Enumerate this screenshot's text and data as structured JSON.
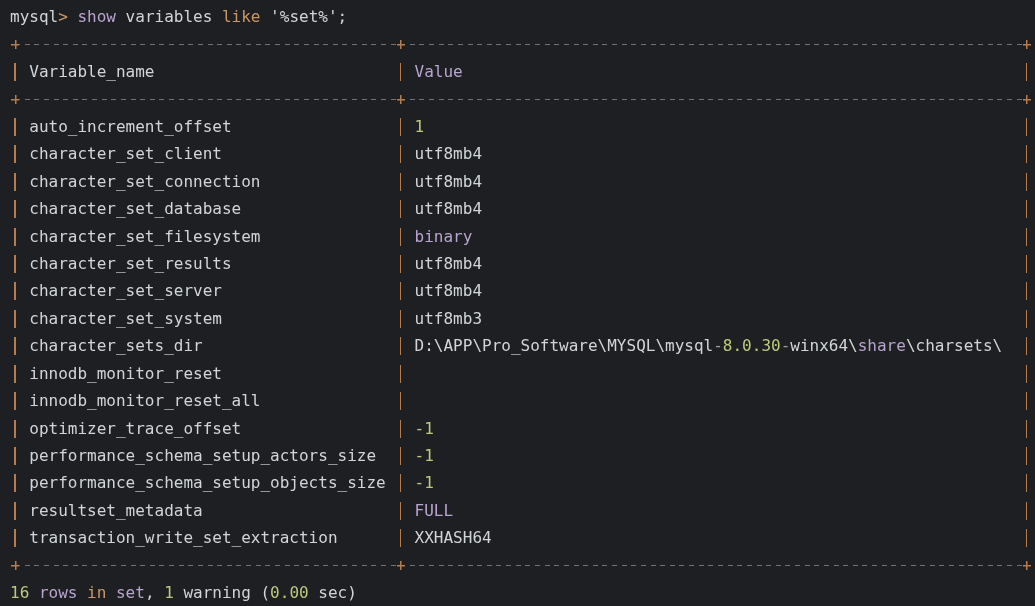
{
  "prompt": {
    "segments": [
      {
        "text": "mysql",
        "kind": "plain"
      },
      {
        "text": ">",
        "kind": "operator"
      },
      {
        "text": " show",
        "kind": "keyword"
      },
      {
        "text": " variables ",
        "kind": "plain"
      },
      {
        "text": "like",
        "kind": "operator"
      },
      {
        "text": " '%set%';",
        "kind": "plain"
      }
    ]
  },
  "table": {
    "columns": [
      {
        "segments": [
          {
            "text": "Variable_name",
            "kind": "plain"
          }
        ]
      },
      {
        "segments": [
          {
            "text": "Value",
            "kind": "keyword"
          }
        ]
      }
    ],
    "rows": [
      {
        "name": [
          {
            "text": "auto_increment_offset",
            "kind": "plain"
          }
        ],
        "value": [
          {
            "text": "1",
            "kind": "number"
          }
        ]
      },
      {
        "name": [
          {
            "text": "character_set_client",
            "kind": "plain"
          }
        ],
        "value": [
          {
            "text": "utf8mb4",
            "kind": "plain"
          }
        ]
      },
      {
        "name": [
          {
            "text": "character_set_connection",
            "kind": "plain"
          }
        ],
        "value": [
          {
            "text": "utf8mb4",
            "kind": "plain"
          }
        ]
      },
      {
        "name": [
          {
            "text": "character_set_database",
            "kind": "plain"
          }
        ],
        "value": [
          {
            "text": "utf8mb4",
            "kind": "plain"
          }
        ]
      },
      {
        "name": [
          {
            "text": "character_set_filesystem",
            "kind": "plain"
          }
        ],
        "value": [
          {
            "text": "binary",
            "kind": "keyword"
          }
        ]
      },
      {
        "name": [
          {
            "text": "character_set_results",
            "kind": "plain"
          }
        ],
        "value": [
          {
            "text": "utf8mb4",
            "kind": "plain"
          }
        ]
      },
      {
        "name": [
          {
            "text": "character_set_server",
            "kind": "plain"
          }
        ],
        "value": [
          {
            "text": "utf8mb4",
            "kind": "plain"
          }
        ]
      },
      {
        "name": [
          {
            "text": "character_set_system",
            "kind": "plain"
          }
        ],
        "value": [
          {
            "text": "utf8mb3",
            "kind": "plain"
          }
        ]
      },
      {
        "name": [
          {
            "text": "character_sets_dir",
            "kind": "plain"
          }
        ],
        "value": [
          {
            "text": "D:\\APP\\Pro_Software\\MYSQL\\mysql",
            "kind": "plain"
          },
          {
            "text": "-",
            "kind": "dim"
          },
          {
            "text": "8.0.30",
            "kind": "number"
          },
          {
            "text": "-",
            "kind": "dim"
          },
          {
            "text": "winx64\\",
            "kind": "plain"
          },
          {
            "text": "share",
            "kind": "keyword"
          },
          {
            "text": "\\charsets\\",
            "kind": "plain"
          }
        ]
      },
      {
        "name": [
          {
            "text": "innodb_monitor_reset",
            "kind": "plain"
          }
        ]
      },
      {
        "name": [
          {
            "text": "innodb_monitor_reset_all",
            "kind": "plain"
          }
        ]
      },
      {
        "name": [
          {
            "text": "optimizer_trace_offset",
            "kind": "plain"
          }
        ],
        "value": [
          {
            "text": "-1",
            "kind": "number"
          }
        ]
      },
      {
        "name": [
          {
            "text": "performance_schema_setup_actors_size",
            "kind": "plain"
          }
        ],
        "value": [
          {
            "text": "-1",
            "kind": "number"
          }
        ]
      },
      {
        "name": [
          {
            "text": "performance_schema_setup_objects_size",
            "kind": "plain"
          }
        ],
        "value": [
          {
            "text": "-1",
            "kind": "number"
          }
        ]
      },
      {
        "name": [
          {
            "text": "resultset_metadata",
            "kind": "plain"
          }
        ],
        "value": [
          {
            "text": "FULL",
            "kind": "keyword"
          }
        ]
      },
      {
        "name": [
          {
            "text": "transaction_write_set_extraction",
            "kind": "plain"
          }
        ],
        "value": [
          {
            "text": "XXHASH64",
            "kind": "plain"
          }
        ]
      }
    ]
  },
  "status": {
    "segments": [
      {
        "text": "16",
        "kind": "number"
      },
      {
        "text": " rows",
        "kind": "keyword"
      },
      {
        "text": " in",
        "kind": "operator"
      },
      {
        "text": " set",
        "kind": "keyword"
      },
      {
        "text": ", ",
        "kind": "plain"
      },
      {
        "text": "1",
        "kind": "number"
      },
      {
        "text": " warning (",
        "kind": "plain"
      },
      {
        "text": "0.00",
        "kind": "number"
      },
      {
        "text": " sec)",
        "kind": "plain"
      }
    ]
  }
}
